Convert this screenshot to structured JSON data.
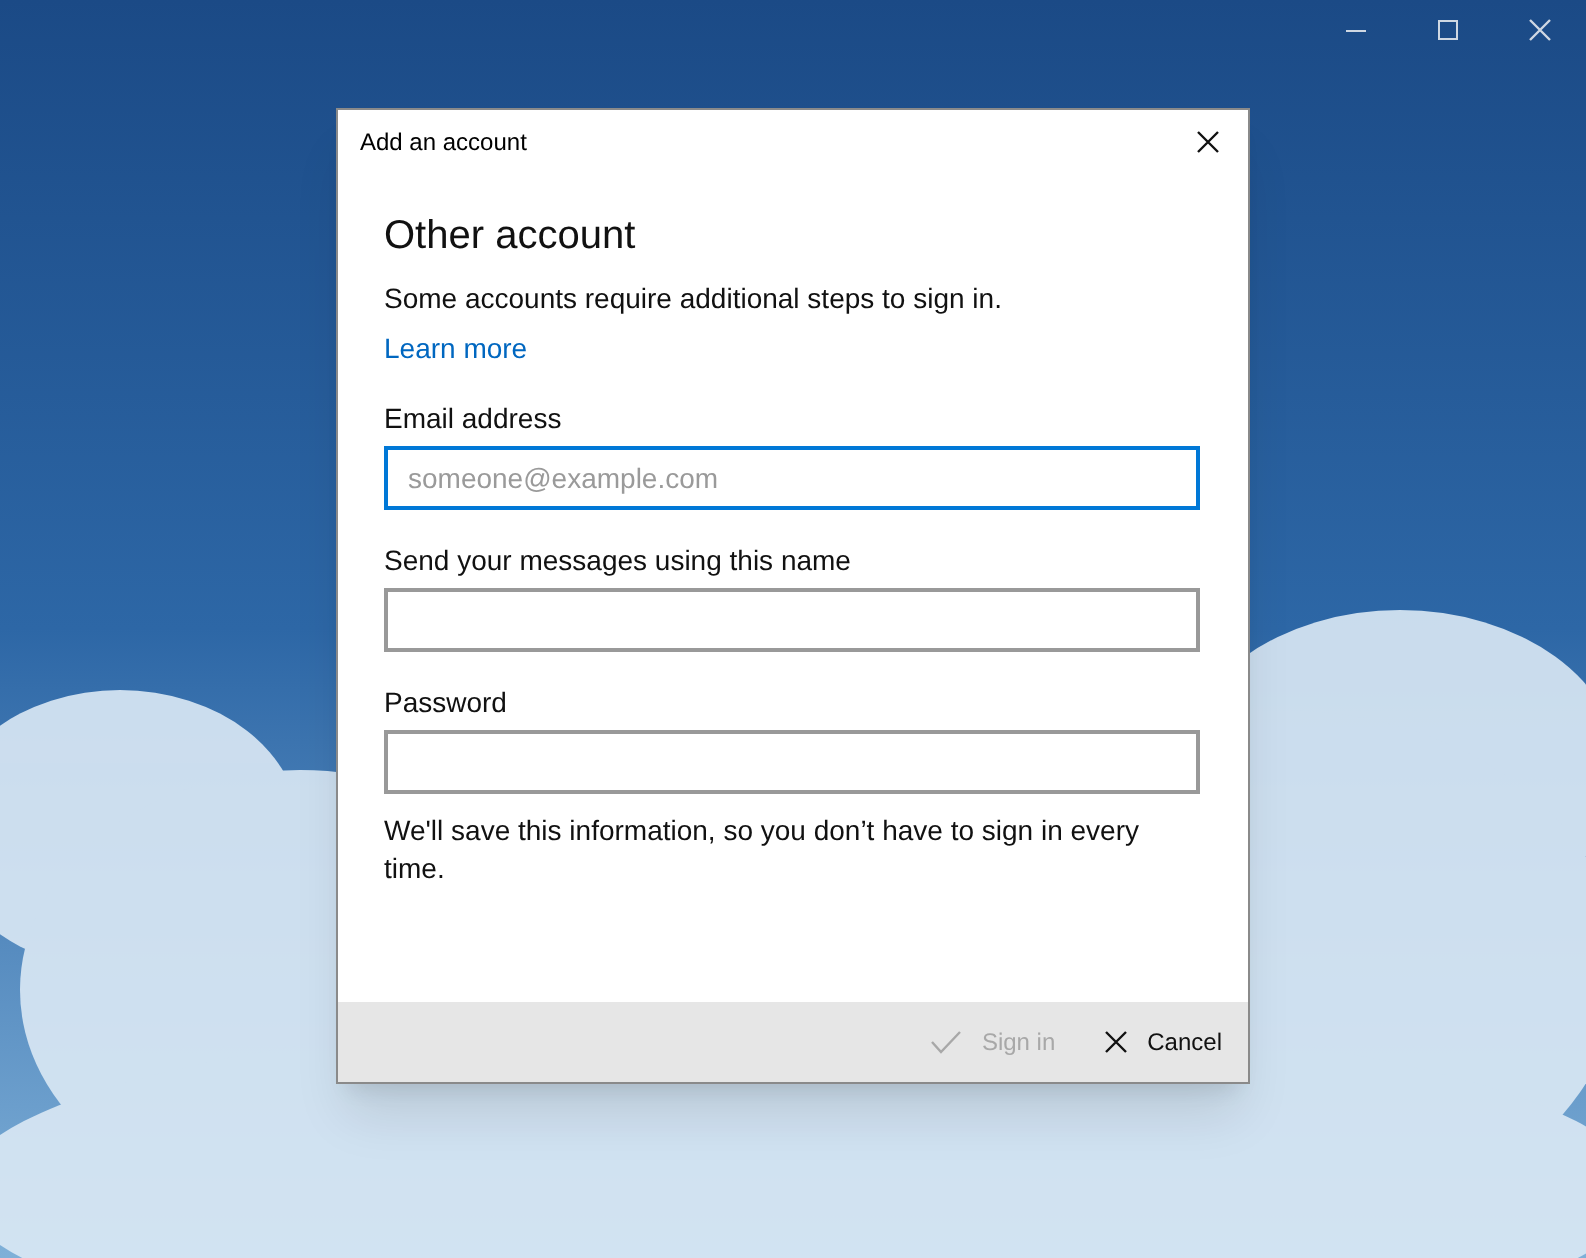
{
  "dialog": {
    "title": "Add an account",
    "heading": "Other account",
    "intro": "Some accounts require additional steps to sign in.",
    "link": "Learn more",
    "fields": [
      {
        "label": "Email address",
        "placeholder": "someone@example.com",
        "focused": true
      },
      {
        "label": "Send your messages using this name",
        "focused": false
      },
      {
        "label": "Password",
        "focused": false
      }
    ],
    "note": "We'll save this information, so you don’t have to sign in every time.",
    "buttons": [
      {
        "kind": "confirm",
        "label": "Sign in",
        "disabled": true
      },
      {
        "kind": "cancel",
        "label": "Cancel",
        "disabled": false
      }
    ]
  }
}
